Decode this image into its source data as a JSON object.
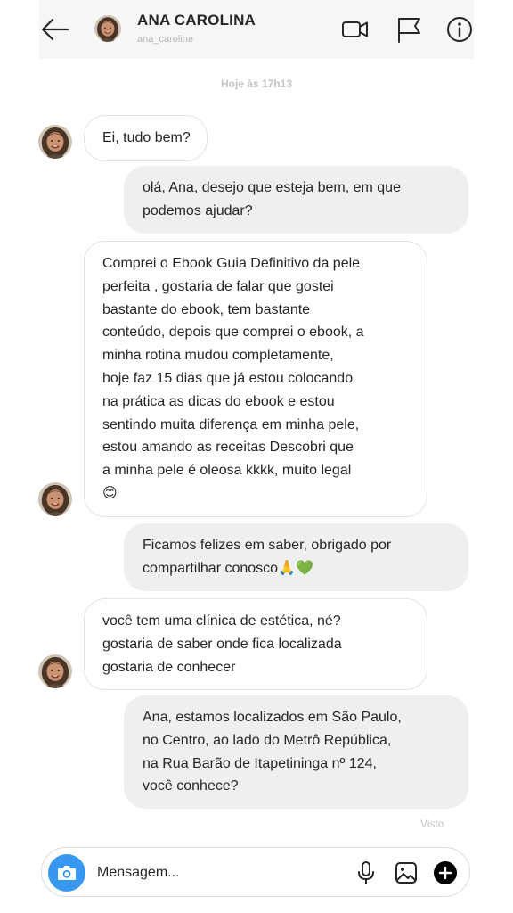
{
  "header": {
    "name": "ANA CAROLINA",
    "username": "ana_caroline"
  },
  "timestamp": "Hoje às 17h13",
  "messages": [
    {
      "from": "them",
      "lines": [
        "Ei, tudo bem?"
      ]
    },
    {
      "from": "me",
      "lines": [
        "olá, Ana, desejo que esteja bem, em que",
        "podemos ajudar?"
      ]
    },
    {
      "from": "them",
      "lines": [
        "Comprei o Ebook Guia Definitivo da pele",
        "perfeita , gostaria de falar que gostei",
        "bastante do ebook, tem bastante",
        "conteúdo, depois que comprei o ebook, a",
        "minha rotina mudou completamente,",
        "hoje faz 15 dias que já estou colocando",
        "na prática as dicas do ebook e estou",
        "sentindo muita diferença em minha pele,",
        "estou amando as receitas Descobri que",
        "a minha pele é oleosa kkkk, muito legal",
        "😊"
      ]
    },
    {
      "from": "me",
      "lines": [
        "Ficamos felizes em saber, obrigado por",
        "compartilhar conosco🙏💚"
      ]
    },
    {
      "from": "them",
      "lines": [
        "você tem uma clínica de estética, né?",
        "gostaria de saber onde fica localizada",
        "gostaria de conhecer"
      ]
    },
    {
      "from": "me",
      "lines": [
        "Ana, estamos localizados em São Paulo,",
        "no Centro, ao lado do Metrô República,",
        "na Rua Barão de Itapetininga nº 124,",
        "você conhece?"
      ]
    }
  ],
  "seen_label": "Visto",
  "composer": {
    "placeholder": "Mensagem..."
  },
  "colors": {
    "accent": "#3897f0",
    "incoming_bubble": "#ffffff",
    "outgoing_bubble": "#efefef",
    "header_bg": "#f6f6f6",
    "muted_text": "#c4c4c4"
  },
  "icons": {
    "header": [
      "back-arrow-icon",
      "video-call-icon",
      "flag-icon",
      "info-icon"
    ],
    "composer": [
      "camera-icon",
      "microphone-icon",
      "image-icon",
      "add-icon"
    ]
  }
}
